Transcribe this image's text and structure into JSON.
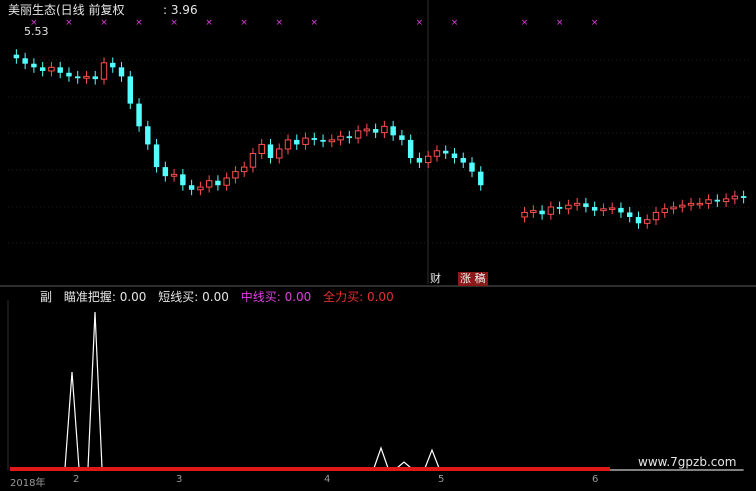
{
  "header": {
    "title": "美丽生态(日线 前复权",
    "top_label": ": 3.96",
    "start_price": "5.53"
  },
  "news_tags": {
    "cai": "财",
    "zhang": "涨 稿"
  },
  "subchart": {
    "prefix": "副",
    "items": [
      {
        "name": "瞄准把握",
        "value": "0.00",
        "color": "#e6e6e6"
      },
      {
        "name": "短线买",
        "value": "0.00",
        "color": "#e6e6e6"
      },
      {
        "name": "中线买",
        "value": "0.00",
        "color": "#e040e0"
      },
      {
        "name": "全力买",
        "value": "0.00",
        "color": "#e03030"
      }
    ]
  },
  "x_axis_labels": [
    "2018年",
    "2",
    "3",
    "4",
    "5",
    "6"
  ],
  "watermark": "www.7gpzb.com",
  "colors": {
    "up": "#ff4f4f",
    "down": "#54ffff",
    "marker": "#e040e0",
    "baseline": "#e01818",
    "gain": "#ffffff"
  },
  "chart_data": [
    {
      "type": "candlestick",
      "title": "美丽生态(日线 前复权",
      "ylim": [
        3.0,
        5.9
      ],
      "gaps": [
        [
          54,
          57
        ]
      ],
      "closes": [
        5.5,
        5.44,
        5.4,
        5.36,
        5.4,
        5.34,
        5.3,
        5.28,
        5.3,
        5.27,
        5.45,
        5.4,
        5.3,
        5.0,
        4.75,
        4.55,
        4.3,
        4.2,
        4.22,
        4.1,
        4.05,
        4.08,
        4.15,
        4.1,
        4.18,
        4.25,
        4.3,
        4.45,
        4.55,
        4.4,
        4.5,
        4.6,
        4.55,
        4.62,
        4.6,
        4.58,
        4.6,
        4.64,
        4.62,
        4.7,
        4.72,
        4.68,
        4.75,
        4.65,
        4.6,
        4.4,
        4.35,
        4.42,
        4.48,
        4.45,
        4.4,
        4.35,
        4.25,
        4.1,
        3.95,
        3.78,
        3.72,
        3.75,
        3.8,
        3.82,
        3.78,
        3.86,
        3.84,
        3.88,
        3.9,
        3.86,
        3.82,
        3.84,
        3.85,
        3.8,
        3.75,
        3.68,
        3.72,
        3.8,
        3.84,
        3.86,
        3.88,
        3.9,
        3.9,
        3.94,
        3.92,
        3.95,
        3.98,
        3.96
      ],
      "marker_days": [
        2,
        6,
        10,
        14,
        18,
        22,
        26,
        30,
        34,
        46,
        50,
        58,
        62,
        66
      ]
    },
    {
      "type": "line",
      "title": "副",
      "ylim": [
        0,
        1
      ],
      "values": [
        0,
        0,
        0,
        0,
        0,
        0,
        0,
        0,
        0,
        0,
        0,
        0,
        0,
        0,
        0,
        0,
        0,
        0,
        0,
        0,
        0,
        0,
        0,
        0,
        0,
        0,
        0,
        0,
        0,
        0,
        0,
        0,
        0,
        0,
        0,
        0,
        0,
        0,
        0,
        0,
        0,
        0,
        0,
        0,
        0,
        0,
        0,
        0,
        0,
        0,
        0,
        0,
        0,
        0,
        0,
        0,
        0,
        0,
        0,
        0,
        0,
        0,
        0,
        0,
        0,
        0,
        0,
        0,
        0,
        0,
        0,
        0,
        0,
        0,
        0,
        0,
        0,
        0,
        0,
        0,
        0,
        0,
        0,
        0
      ]
    }
  ]
}
